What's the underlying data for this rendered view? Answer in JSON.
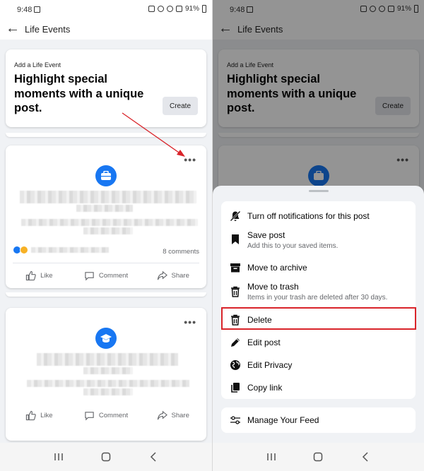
{
  "status": {
    "time": "9:48",
    "battery": "91%"
  },
  "appbar": {
    "title": "Life Events"
  },
  "add_event": {
    "label": "Add a Life Event",
    "headline": "Highlight special moments with a unique post.",
    "create_label": "Create"
  },
  "post1": {
    "comments": "8 comments",
    "actions": {
      "like": "Like",
      "comment": "Comment",
      "share": "Share"
    }
  },
  "post2": {
    "actions": {
      "like": "Like",
      "comment": "Comment",
      "share": "Share"
    }
  },
  "menu": {
    "items": [
      {
        "label": "Turn off notifications for this post",
        "icon": "bell-off-icon"
      },
      {
        "label": "Save post",
        "sub": "Add this to your saved items.",
        "icon": "bookmark-icon"
      },
      {
        "label": "Move to archive",
        "icon": "archive-icon"
      },
      {
        "label": "Move to trash",
        "sub": "Items in your trash are deleted after 30 days.",
        "icon": "trash-icon"
      },
      {
        "label": "Delete",
        "icon": "trash-icon"
      },
      {
        "label": "Edit post",
        "icon": "pencil-icon"
      },
      {
        "label": "Edit Privacy",
        "icon": "globe-icon"
      },
      {
        "label": "Copy link",
        "icon": "copy-icon"
      }
    ],
    "feed": {
      "label": "Manage Your Feed",
      "icon": "sliders-icon"
    }
  },
  "colors": {
    "brand": "#1877f2",
    "highlight": "#d9242a",
    "annotation_arrow": "#d9242a"
  }
}
